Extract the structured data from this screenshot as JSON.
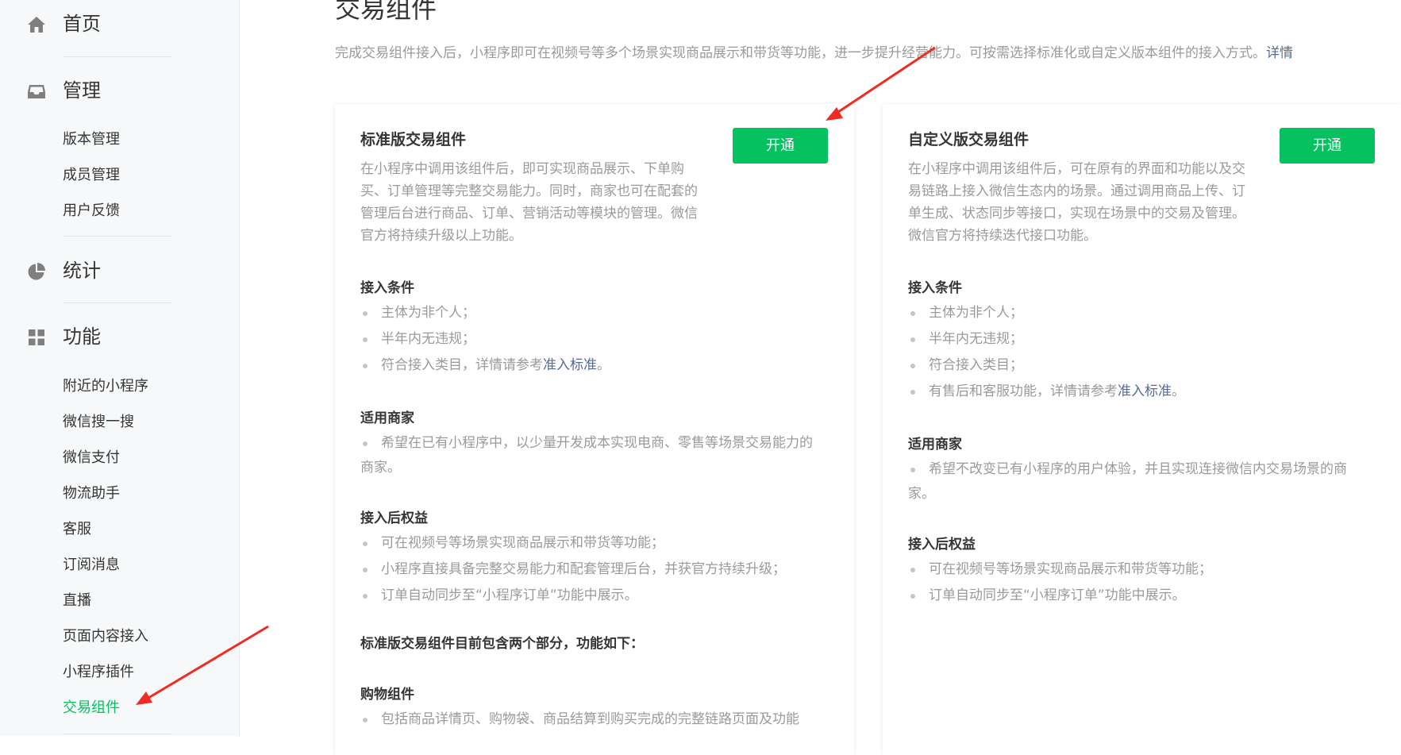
{
  "sidebar": {
    "sections": [
      {
        "label": "首页",
        "icon": "home-icon"
      },
      {
        "label": "管理",
        "icon": "inbox-icon",
        "items": [
          "版本管理",
          "成员管理",
          "用户反馈"
        ]
      },
      {
        "label": "统计",
        "icon": "pie-chart-icon"
      },
      {
        "label": "功能",
        "icon": "grid-icon",
        "items": [
          "附近的小程序",
          "微信搜一搜",
          "微信支付",
          "物流助手",
          "客服",
          "订阅消息",
          "直播",
          "页面内容接入",
          "小程序插件",
          "交易组件"
        ]
      }
    ],
    "active_item": "交易组件",
    "active_color": "#07c160"
  },
  "main": {
    "title": "交易组件",
    "description": "完成交易组件接入后，小程序即可在视频号等多个场景实现商品展示和带货等功能，进一步提升经营能力。可按需选择标准化或自定义版本组件的接入方式。",
    "description_link": "详情"
  },
  "standard_card": {
    "title": "标准版交易组件",
    "open_label": "开通",
    "desc_lines": [
      "在小程序中调用该组件后，即可实现商品展示、下单购",
      "买、订单管理等完整交易能力。同时，商家也可在配套的",
      "管理后台进行商品、订单、营销活动等模块的管理。微信",
      "官方将持续升级以上功能。"
    ],
    "conditions_title": "接入条件",
    "conditions": [
      "主体为非个人；",
      "半年内无违规；",
      "符合接入类目，详情请参考"
    ],
    "conditions_link": "准入标准",
    "conditions_link_suffix": "。",
    "merchants_title": "适用商家",
    "merchants_line1": "希望在已有小程序中，以少量开发成本实现电商、零售等场景交易能力的",
    "merchants_line2": "商家。",
    "benefits_title": "接入后权益",
    "benefits": [
      "可在视频号等场景实现商品展示和带货等功能；",
      "小程序直接具备完整交易能力和配套管理后台，并获官方持续升级；",
      "订单自动同步至“小程序订单”功能中展示。"
    ],
    "parts_title": "标准版交易组件目前包含两个部分，功能如下：",
    "shopping_title": "购物组件",
    "shopping_items": [
      "包括商品详情页、购物袋、商品结算到购买完成的完整链路页面及功能"
    ]
  },
  "custom_card": {
    "title": "自定义版交易组件",
    "open_label": "开通",
    "desc_lines": [
      "在小程序中调用该组件后，可在原有的界面和功能以及交",
      "易链路上接入微信生态内的场景。通过调用商品上传、订",
      "单生成、状态同步等接口，实现在场景中的交易及管理。",
      "微信官方将持续迭代接口功能。"
    ],
    "conditions_title": "接入条件",
    "conditions": [
      "主体为非个人；",
      "半年内无违规；",
      "符合接入类目；",
      "有售后和客服功能，详情请参考"
    ],
    "conditions_link": "准入标准",
    "conditions_link_suffix": "。",
    "merchants_title": "适用商家",
    "merchants_line1": "希望不改变已有小程序的用户体验，并且实现连接微信内交易场景的商",
    "merchants_line2": "家。",
    "benefits_title": "接入后权益",
    "benefits": [
      "可在视频号等场景实现商品展示和带货等功能；",
      "订单自动同步至“小程序订单”功能中展示。"
    ]
  },
  "colors": {
    "accent": "#07c160",
    "link": "#576b95",
    "muted_text": "#9a9a9a",
    "annotation_arrow": "#ef2b23"
  }
}
